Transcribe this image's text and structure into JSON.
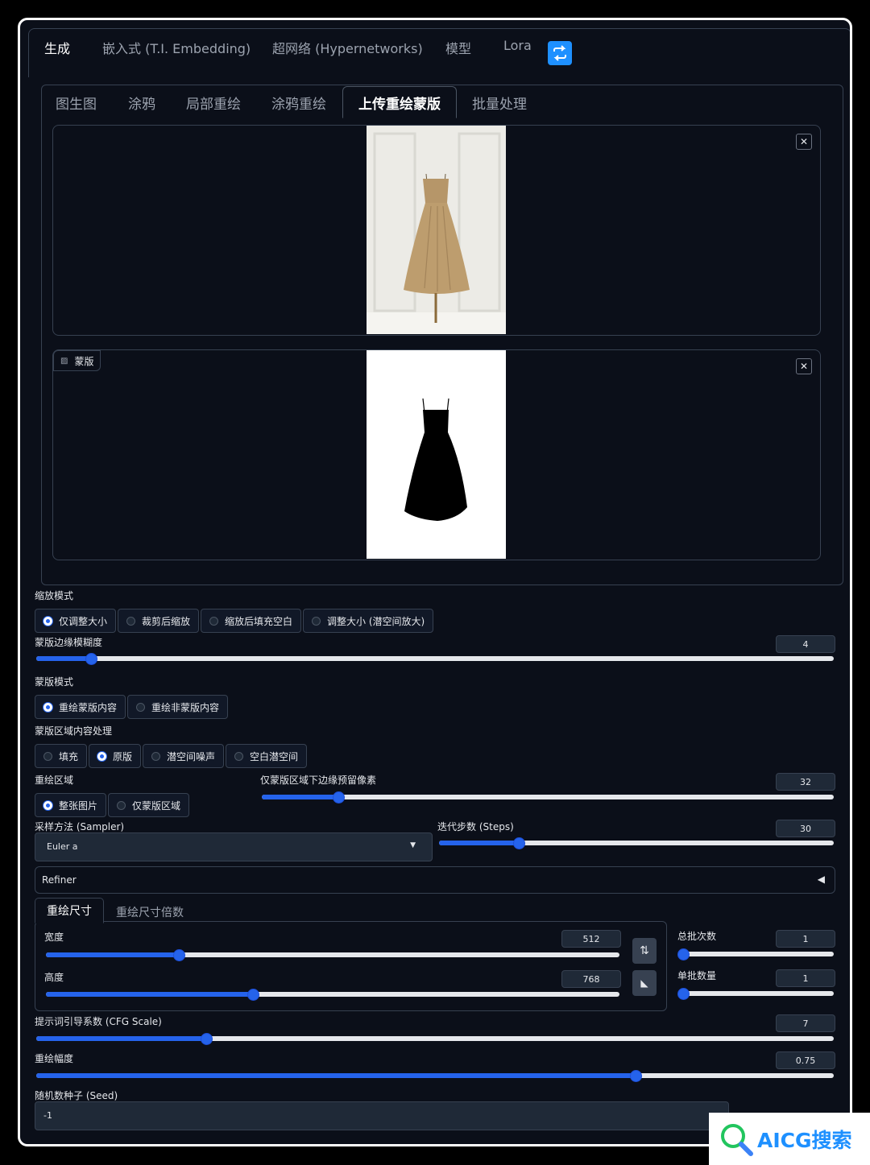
{
  "top_tabs": [
    "生成",
    "嵌入式 (T.I. Embedding)",
    "超网络 (Hypernetworks)",
    "模型",
    "Lora"
  ],
  "sub_tabs": [
    "图生图",
    "涂鸦",
    "局部重绘",
    "涂鸦重绘",
    "上传重绘蒙版",
    "批量处理"
  ],
  "mask_label": "蒙版",
  "resize_mode": {
    "label": "缩放模式",
    "options": [
      "仅调整大小",
      "裁剪后缩放",
      "缩放后填充空白",
      "调整大小 (潜空间放大)"
    ],
    "selected": 0
  },
  "mask_blur": {
    "label": "蒙版边缘模糊度",
    "value": "4",
    "fraction": 0.068
  },
  "mask_mode": {
    "label": "蒙版模式",
    "options": [
      "重绘蒙版内容",
      "重绘非蒙版内容"
    ],
    "selected": 0
  },
  "masked_content": {
    "label": "蒙版区域内容处理",
    "options": [
      "填充",
      "原版",
      "潜空间噪声",
      "空白潜空间"
    ],
    "selected": 1
  },
  "inpaint_area": {
    "label": "重绘区域",
    "options": [
      "整张图片",
      "仅蒙版区域"
    ],
    "selected": 0
  },
  "padding": {
    "label": "仅蒙版区域下边缘预留像素",
    "value": "32",
    "fraction": 0.132
  },
  "sampler": {
    "label": "采样方法 (Sampler)",
    "value": "Euler a"
  },
  "steps": {
    "label": "迭代步数 (Steps)",
    "value": "30",
    "fraction": 0.2
  },
  "refiner": {
    "label": "Refiner"
  },
  "size_tabs": [
    "重绘尺寸",
    "重绘尺寸倍数"
  ],
  "width": {
    "label": "宽度",
    "value": "512",
    "fraction": 0.23
  },
  "height": {
    "label": "高度",
    "value": "768",
    "fraction": 0.36
  },
  "batch_count": {
    "label": "总批次数",
    "value": "1",
    "fraction": 0.0
  },
  "batch_size": {
    "label": "单批数量",
    "value": "1",
    "fraction": 0.0
  },
  "cfg": {
    "label": "提示词引导系数 (CFG Scale)",
    "value": "7",
    "fraction": 0.212
  },
  "denoise": {
    "label": "重绘幅度",
    "value": "0.75",
    "fraction": 0.75
  },
  "seed": {
    "label": "随机数种子 (Seed)",
    "value": "-1"
  },
  "watermark": "AICG搜索"
}
